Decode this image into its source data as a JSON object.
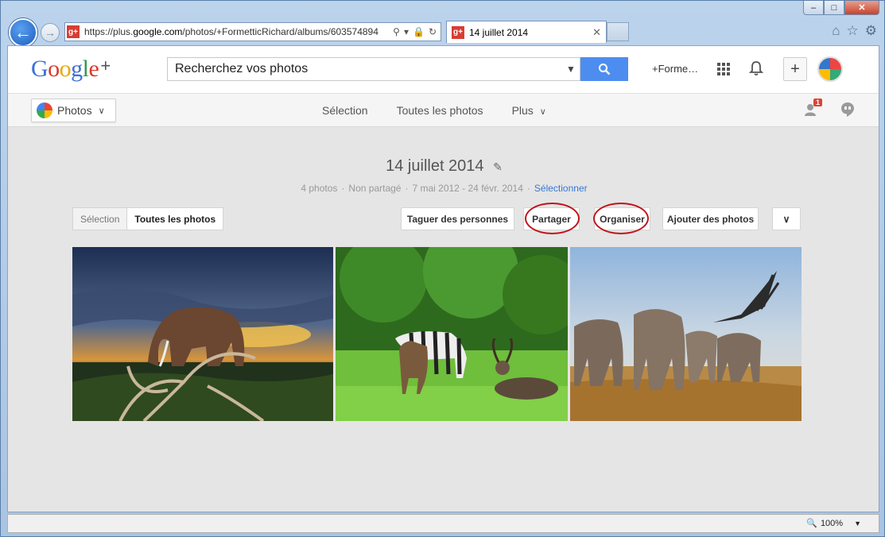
{
  "browser": {
    "url_prefix": "https://plus.",
    "url_domain": "google.com",
    "url_path": "/photos/+FormetticRichard/albums/603574894",
    "tab_title": "14 juillet 2014",
    "window_controls": [
      "–",
      "□",
      "✕"
    ],
    "zoom": "100%"
  },
  "header": {
    "logo_parts": [
      "G",
      "o",
      "o",
      "g",
      "l",
      "e"
    ],
    "logo_plus": "+",
    "search_placeholder": "Recherchez vos photos",
    "user_label": "+Forme…",
    "add_label": "+"
  },
  "subbar": {
    "photos_label": "Photos",
    "nav": [
      "Sélection",
      "Toutes les photos",
      "Plus"
    ],
    "notif_count": "1"
  },
  "album": {
    "title": "14 juillet 2014",
    "count": "4 photos",
    "sharing": "Non partagé",
    "dates": "7 mai 2012 - 24 févr. 2014",
    "select_link": "Sélectionner",
    "separator": "·"
  },
  "toolbar": {
    "seg_selection": "Sélection",
    "seg_all": "Toutes les photos",
    "tag": "Taguer des personnes",
    "share": "Partager",
    "organize": "Organiser",
    "add_photos": "Ajouter des photos"
  },
  "colors": {
    "annotation_circle": "#c0141b",
    "link_blue": "#3a77d4",
    "search_blue": "#4d8df0"
  },
  "photos": [
    {
      "subject": "elephant-sunset"
    },
    {
      "subject": "zebra-waterbuck"
    },
    {
      "subject": "elephant-herd-stork"
    }
  ]
}
